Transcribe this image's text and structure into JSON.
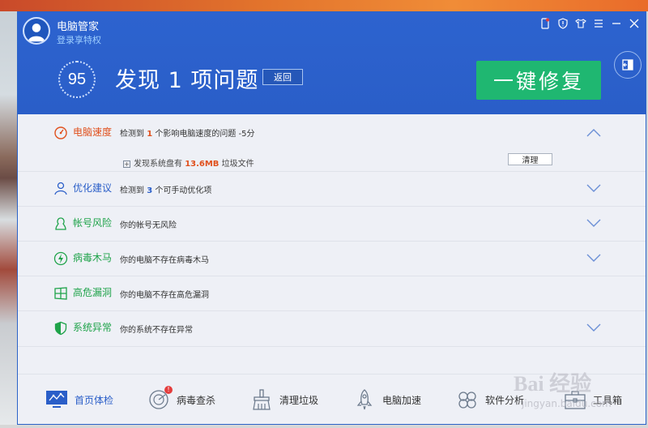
{
  "window": {
    "app_title": "电脑管家",
    "login_link": "登录享特权"
  },
  "header": {
    "score": "95",
    "issue_title": "发现 1 项问题",
    "back_label": "返回",
    "fix_label": "一键修复"
  },
  "rows": [
    {
      "label": "电脑速度",
      "color": "#e0501d",
      "desc_pre": "检测到 ",
      "desc_num": "1",
      "desc_post": " 个影响电脑速度的问题  -5分",
      "expanded": true
    },
    {
      "label": "优化建议",
      "color": "#2a5ec8",
      "desc_pre": "检测到 ",
      "desc_num": "3",
      "desc_post": " 个可手动优化项",
      "expanded": false
    },
    {
      "label": "帐号风险",
      "color": "#1fa34a",
      "desc": "你的帐号无风险",
      "expanded": false
    },
    {
      "label": "病毒木马",
      "color": "#1fa34a",
      "desc": "你的电脑不存在病毒木马",
      "expanded": false
    },
    {
      "label": "高危漏洞",
      "color": "#1fa34a",
      "desc": "你的电脑不存在高危漏洞",
      "expanded": false
    },
    {
      "label": "系统异常",
      "color": "#1fa34a",
      "desc": "你的系统不存在异常",
      "expanded": false
    }
  ],
  "speed_detail": {
    "pre": "发现系统盘有 ",
    "size": "13.6MB",
    "post": " 垃圾文件",
    "clean_label": "清理"
  },
  "bottom_nav": [
    {
      "label": "首页体检",
      "active": true
    },
    {
      "label": "病毒查杀",
      "badge": "!"
    },
    {
      "label": "清理垃圾"
    },
    {
      "label": "电脑加速"
    },
    {
      "label": "软件分析"
    },
    {
      "label": "工具箱"
    }
  ],
  "watermark": {
    "main": "Bai 经验",
    "sub": "jingyan.baidu.com"
  }
}
